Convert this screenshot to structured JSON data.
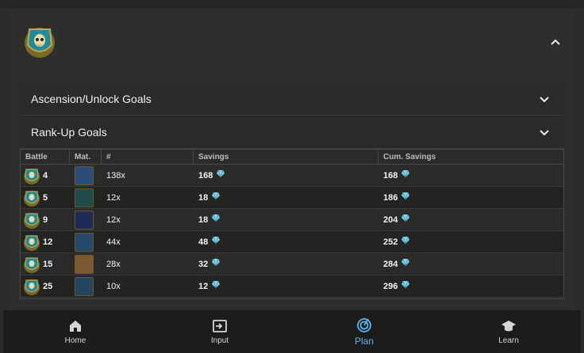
{
  "accordions": [
    {
      "label": "Ascension/Unlock Goals"
    },
    {
      "label": "Rank-Up Goals"
    }
  ],
  "table": {
    "headers": [
      "Battle",
      "Mat.",
      "#",
      "Savings",
      "Cum. Savings"
    ],
    "rows": [
      {
        "battle": "4",
        "material_color": "#2b4d7a",
        "count": "138x",
        "savings": "168",
        "cum": "168"
      },
      {
        "battle": "5",
        "material_color": "#1f4a4a",
        "count": "12x",
        "savings": "18",
        "cum": "186"
      },
      {
        "battle": "9",
        "material_color": "#1e2a55",
        "count": "12x",
        "savings": "18",
        "cum": "204"
      },
      {
        "battle": "12",
        "material_color": "#254a6a",
        "count": "44x",
        "savings": "48",
        "cum": "252"
      },
      {
        "battle": "15",
        "material_color": "#7a5a30",
        "count": "28x",
        "savings": "32",
        "cum": "284"
      },
      {
        "battle": "25",
        "material_color": "#23455e",
        "count": "10x",
        "savings": "12",
        "cum": "296"
      }
    ]
  },
  "nav": [
    {
      "label": "Home",
      "icon": "home-icon"
    },
    {
      "label": "Input",
      "icon": "input-icon"
    },
    {
      "label": "Plan",
      "icon": "plan-icon",
      "active": true
    },
    {
      "label": "Learn",
      "icon": "learn-icon"
    }
  ],
  "colors": {
    "accent": "#5fb3f0",
    "gem": "#7fd6f0"
  }
}
